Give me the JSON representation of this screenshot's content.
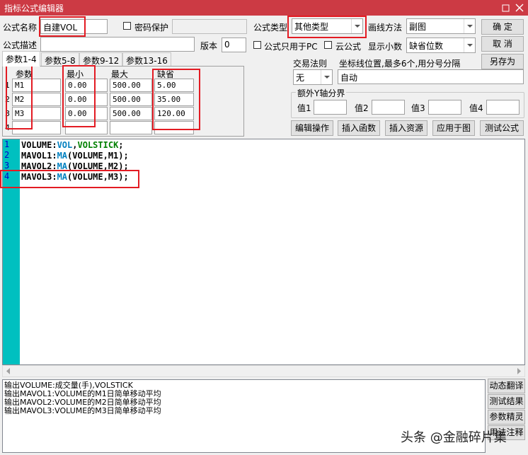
{
  "window": {
    "title": "指标公式编辑器"
  },
  "form": {
    "name_label": "公式名称",
    "name_value": "自建VOL",
    "password_label": "密码保护",
    "password_value": "",
    "type_label": "公式类型",
    "type_value": "其他类型",
    "draw_label": "画线方法",
    "draw_value": "副图",
    "desc_label": "公式描述",
    "desc_value": "",
    "version_label": "版本",
    "version_value": "0",
    "pc_only_label": "公式只用于PC",
    "cloud_label": "云公式",
    "decimal_label": "显示小数",
    "decimal_value": "缺省位数"
  },
  "buttons": {
    "ok": "确 定",
    "cancel": "取 消",
    "save_as": "另存为",
    "edit": "编辑操作",
    "insert_func": "插入函数",
    "insert_res": "插入资源",
    "apply": "应用于图",
    "test": "测试公式"
  },
  "tabs": [
    "参数1-4",
    "参数5-8",
    "参数9-12",
    "参数13-16"
  ],
  "params": {
    "headers": {
      "name": "参数",
      "min": "最小",
      "max": "最大",
      "default": "缺省"
    },
    "rows": [
      {
        "num": "1",
        "name": "M1",
        "min": "0.00",
        "max": "500.00",
        "default": "5.00"
      },
      {
        "num": "2",
        "name": "M2",
        "min": "0.00",
        "max": "500.00",
        "default": "35.00"
      },
      {
        "num": "3",
        "name": "M3",
        "min": "0.00",
        "max": "500.00",
        "default": "120.00"
      },
      {
        "num": "4",
        "name": "",
        "min": "",
        "max": "",
        "default": ""
      }
    ]
  },
  "trade": {
    "rule_label": "交易法则",
    "rule_value": "无",
    "coord_label": "坐标线位置,最多6个,用分号分隔",
    "coord_value": "自动",
    "axis_group": "额外Y轴分界",
    "axis_labels": [
      "值1",
      "值2",
      "值3",
      "值4"
    ]
  },
  "code": {
    "lines": [
      {
        "num": "1",
        "a": "VOLUME:",
        "b": "VOL",
        "c": ",",
        "d": "VOLSTICK",
        "e": ";"
      },
      {
        "num": "2",
        "a": "MAVOL1:",
        "b": "MA",
        "c": "(VOLUME,M1);",
        "d": "",
        "e": ""
      },
      {
        "num": "3",
        "a": "MAVOL2:",
        "b": "MA",
        "c": "(VOLUME,M2);",
        "d": "",
        "e": ""
      },
      {
        "num": "4",
        "a": "MAVOL3:",
        "b": "MA",
        "c": "(VOLUME,M3);",
        "d": "",
        "e": ""
      }
    ]
  },
  "output": {
    "lines": [
      "输出VOLUME:成交量(手),VOLSTICK",
      "输出MAVOL1:VOLUME的M1日简单移动平均",
      "输出MAVOL2:VOLUME的M2日简单移动平均",
      "输出MAVOL3:VOLUME的M3日简单移动平均"
    ]
  },
  "side_buttons": [
    "动态翻译",
    "测试结果",
    "参数精灵",
    "用法注释"
  ],
  "watermark": "头条 @金融碎片集",
  "colors": {
    "title_bar": "#cc3a44",
    "gutter": "#00c0c0",
    "highlight": "#e31b23"
  }
}
